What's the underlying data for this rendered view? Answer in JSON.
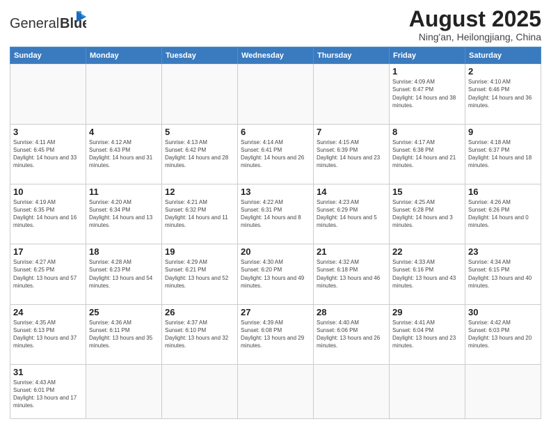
{
  "header": {
    "logo_general": "General",
    "logo_blue": "Blue",
    "month_title": "August 2025",
    "location": "Ning'an, Heilongjiang, China"
  },
  "weekdays": [
    "Sunday",
    "Monday",
    "Tuesday",
    "Wednesday",
    "Thursday",
    "Friday",
    "Saturday"
  ],
  "weeks": [
    [
      {
        "day": "",
        "info": ""
      },
      {
        "day": "",
        "info": ""
      },
      {
        "day": "",
        "info": ""
      },
      {
        "day": "",
        "info": ""
      },
      {
        "day": "",
        "info": ""
      },
      {
        "day": "1",
        "info": "Sunrise: 4:09 AM\nSunset: 6:47 PM\nDaylight: 14 hours and 38 minutes."
      },
      {
        "day": "2",
        "info": "Sunrise: 4:10 AM\nSunset: 6:46 PM\nDaylight: 14 hours and 36 minutes."
      }
    ],
    [
      {
        "day": "3",
        "info": "Sunrise: 4:11 AM\nSunset: 6:45 PM\nDaylight: 14 hours and 33 minutes."
      },
      {
        "day": "4",
        "info": "Sunrise: 4:12 AM\nSunset: 6:43 PM\nDaylight: 14 hours and 31 minutes."
      },
      {
        "day": "5",
        "info": "Sunrise: 4:13 AM\nSunset: 6:42 PM\nDaylight: 14 hours and 28 minutes."
      },
      {
        "day": "6",
        "info": "Sunrise: 4:14 AM\nSunset: 6:41 PM\nDaylight: 14 hours and 26 minutes."
      },
      {
        "day": "7",
        "info": "Sunrise: 4:15 AM\nSunset: 6:39 PM\nDaylight: 14 hours and 23 minutes."
      },
      {
        "day": "8",
        "info": "Sunrise: 4:17 AM\nSunset: 6:38 PM\nDaylight: 14 hours and 21 minutes."
      },
      {
        "day": "9",
        "info": "Sunrise: 4:18 AM\nSunset: 6:37 PM\nDaylight: 14 hours and 18 minutes."
      }
    ],
    [
      {
        "day": "10",
        "info": "Sunrise: 4:19 AM\nSunset: 6:35 PM\nDaylight: 14 hours and 16 minutes."
      },
      {
        "day": "11",
        "info": "Sunrise: 4:20 AM\nSunset: 6:34 PM\nDaylight: 14 hours and 13 minutes."
      },
      {
        "day": "12",
        "info": "Sunrise: 4:21 AM\nSunset: 6:32 PM\nDaylight: 14 hours and 11 minutes."
      },
      {
        "day": "13",
        "info": "Sunrise: 4:22 AM\nSunset: 6:31 PM\nDaylight: 14 hours and 8 minutes."
      },
      {
        "day": "14",
        "info": "Sunrise: 4:23 AM\nSunset: 6:29 PM\nDaylight: 14 hours and 5 minutes."
      },
      {
        "day": "15",
        "info": "Sunrise: 4:25 AM\nSunset: 6:28 PM\nDaylight: 14 hours and 3 minutes."
      },
      {
        "day": "16",
        "info": "Sunrise: 4:26 AM\nSunset: 6:26 PM\nDaylight: 14 hours and 0 minutes."
      }
    ],
    [
      {
        "day": "17",
        "info": "Sunrise: 4:27 AM\nSunset: 6:25 PM\nDaylight: 13 hours and 57 minutes."
      },
      {
        "day": "18",
        "info": "Sunrise: 4:28 AM\nSunset: 6:23 PM\nDaylight: 13 hours and 54 minutes."
      },
      {
        "day": "19",
        "info": "Sunrise: 4:29 AM\nSunset: 6:21 PM\nDaylight: 13 hours and 52 minutes."
      },
      {
        "day": "20",
        "info": "Sunrise: 4:30 AM\nSunset: 6:20 PM\nDaylight: 13 hours and 49 minutes."
      },
      {
        "day": "21",
        "info": "Sunrise: 4:32 AM\nSunset: 6:18 PM\nDaylight: 13 hours and 46 minutes."
      },
      {
        "day": "22",
        "info": "Sunrise: 4:33 AM\nSunset: 6:16 PM\nDaylight: 13 hours and 43 minutes."
      },
      {
        "day": "23",
        "info": "Sunrise: 4:34 AM\nSunset: 6:15 PM\nDaylight: 13 hours and 40 minutes."
      }
    ],
    [
      {
        "day": "24",
        "info": "Sunrise: 4:35 AM\nSunset: 6:13 PM\nDaylight: 13 hours and 37 minutes."
      },
      {
        "day": "25",
        "info": "Sunrise: 4:36 AM\nSunset: 6:11 PM\nDaylight: 13 hours and 35 minutes."
      },
      {
        "day": "26",
        "info": "Sunrise: 4:37 AM\nSunset: 6:10 PM\nDaylight: 13 hours and 32 minutes."
      },
      {
        "day": "27",
        "info": "Sunrise: 4:39 AM\nSunset: 6:08 PM\nDaylight: 13 hours and 29 minutes."
      },
      {
        "day": "28",
        "info": "Sunrise: 4:40 AM\nSunset: 6:06 PM\nDaylight: 13 hours and 26 minutes."
      },
      {
        "day": "29",
        "info": "Sunrise: 4:41 AM\nSunset: 6:04 PM\nDaylight: 13 hours and 23 minutes."
      },
      {
        "day": "30",
        "info": "Sunrise: 4:42 AM\nSunset: 6:03 PM\nDaylight: 13 hours and 20 minutes."
      }
    ],
    [
      {
        "day": "31",
        "info": "Sunrise: 4:43 AM\nSunset: 6:01 PM\nDaylight: 13 hours and 17 minutes."
      },
      {
        "day": "",
        "info": ""
      },
      {
        "day": "",
        "info": ""
      },
      {
        "day": "",
        "info": ""
      },
      {
        "day": "",
        "info": ""
      },
      {
        "day": "",
        "info": ""
      },
      {
        "day": "",
        "info": ""
      }
    ]
  ]
}
